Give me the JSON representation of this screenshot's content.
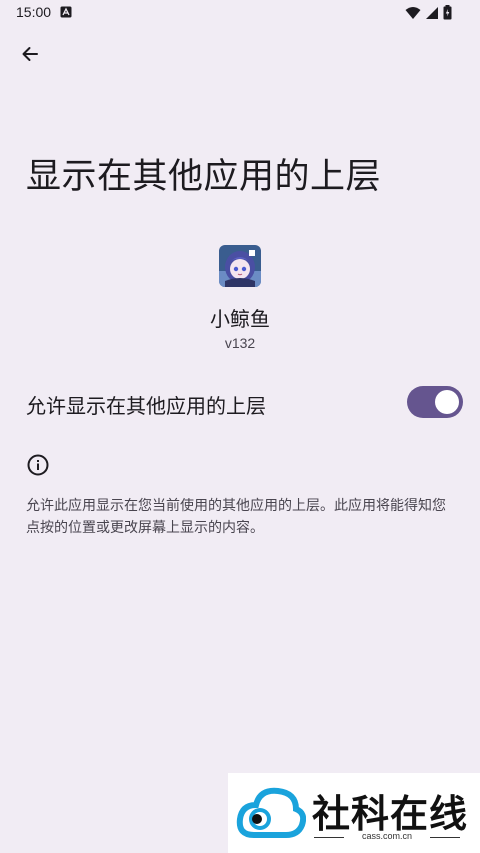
{
  "status_bar": {
    "time": "15:00",
    "notification_icon": "a-box-icon",
    "right_icons": [
      "wifi-icon",
      "signal-icon",
      "battery-icon"
    ]
  },
  "toolbar": {
    "back_icon": "arrow-left-icon"
  },
  "page": {
    "title": "显示在其他应用的上层"
  },
  "app": {
    "icon": "app-avatar-icon",
    "name": "小鲸鱼",
    "version": "v132"
  },
  "permission": {
    "label": "允许显示在其他应用的上层",
    "enabled": true
  },
  "info": {
    "icon": "info-icon",
    "description": "允许此应用显示在您当前使用的其他应用的上层。此应用将能得知您点按的位置或更改屏幕上显示的内容。"
  },
  "watermark": {
    "text": "社科在线",
    "sub": "cass.com.cn",
    "colors": {
      "cloud": "#1aa3dc"
    }
  },
  "colors": {
    "background": "#f1ecf4",
    "toggle_track": "#65558f",
    "toggle_thumb": "#ffffff"
  }
}
